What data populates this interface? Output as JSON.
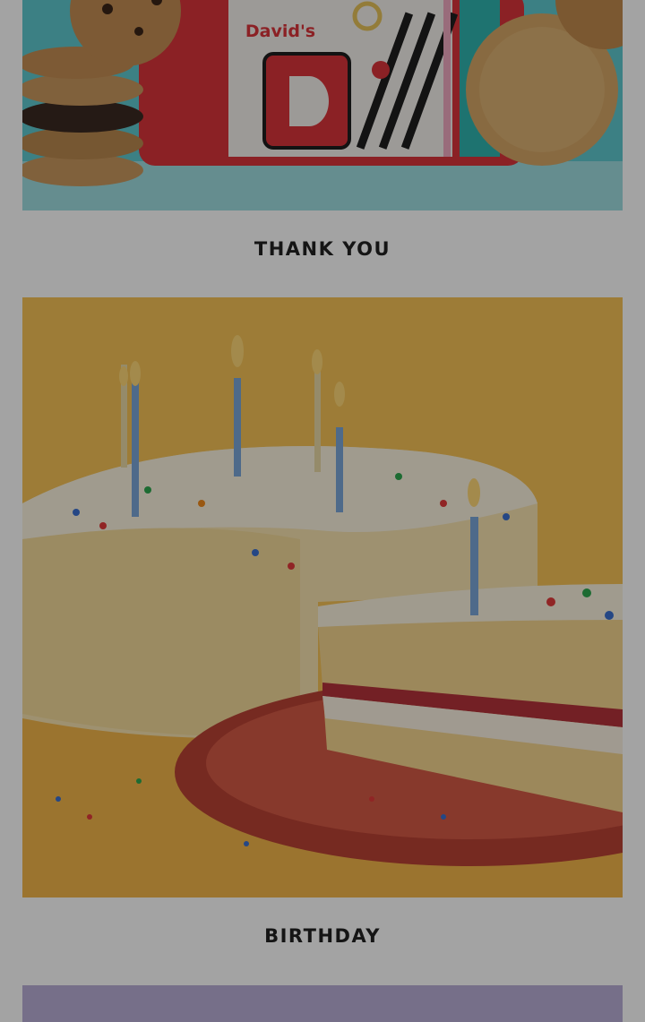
{
  "tiles": [
    {
      "label": "THANK YOU",
      "image": "cookie-tin-with-cookies",
      "tin_brand": "David's"
    },
    {
      "label": "BIRTHDAY",
      "image": "birthday-cake-with-candles"
    },
    {
      "label": "",
      "image": "partial-next-tile"
    }
  ],
  "colors": {
    "thankyou_background": "#5fc9cf",
    "tin_red": "#d9343a",
    "birthday_background": "#f6c356",
    "plate_red": "#c94b3c",
    "next_tile_background": "#b9aed6",
    "overlay": "rgba(0,0,0,0.36)"
  }
}
